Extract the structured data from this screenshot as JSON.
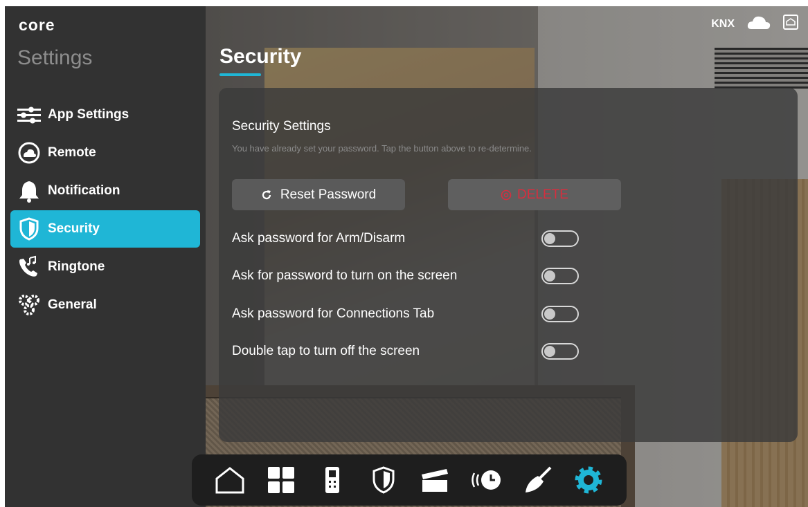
{
  "app": {
    "logo": "core"
  },
  "sidebar": {
    "title": "Settings",
    "items": [
      {
        "label": "App Settings",
        "icon": "sliders-icon",
        "active": false
      },
      {
        "label": "Remote",
        "icon": "cloud-remote-icon",
        "active": false
      },
      {
        "label": "Notification",
        "icon": "bell-icon",
        "active": false
      },
      {
        "label": "Security",
        "icon": "shield-icon",
        "active": true
      },
      {
        "label": "Ringtone",
        "icon": "phone-music-icon",
        "active": false
      },
      {
        "label": "General",
        "icon": "gears-icon",
        "active": false
      }
    ]
  },
  "header": {
    "title": "Security",
    "status": {
      "knx_label": "KNX",
      "cloud_icon": "cloud-icon",
      "home_icon": "home-status-icon"
    }
  },
  "panel": {
    "section_title": "Security Settings",
    "description": "You have already set your password. Tap the button above to re-determine.",
    "reset_button": {
      "label": "Reset Password",
      "icon": "refresh-icon"
    },
    "delete_button": {
      "label": "DELETE",
      "icon": "delete-circle-icon"
    },
    "toggles": [
      {
        "label": "Ask password for Arm/Disarm",
        "on": false
      },
      {
        "label": "Ask for password to turn on the screen",
        "on": false
      },
      {
        "label": "Ask password for Connections Tab",
        "on": false
      },
      {
        "label": "Double tap to turn off the screen",
        "on": false
      }
    ]
  },
  "dock": {
    "items": [
      {
        "icon": "home-icon",
        "active": false
      },
      {
        "icon": "grid-icon",
        "active": false
      },
      {
        "icon": "intercom-icon",
        "active": false
      },
      {
        "icon": "shield-icon",
        "active": false
      },
      {
        "icon": "clapperboard-icon",
        "active": false
      },
      {
        "icon": "schedule-icon",
        "active": false
      },
      {
        "icon": "cleaning-icon",
        "active": false
      },
      {
        "icon": "gear-icon",
        "active": true
      }
    ]
  },
  "colors": {
    "accent": "#1fb6d6",
    "danger": "#d62e3f",
    "sidebar_bg": "#323232",
    "panel_bg": "#3a3a3a"
  }
}
